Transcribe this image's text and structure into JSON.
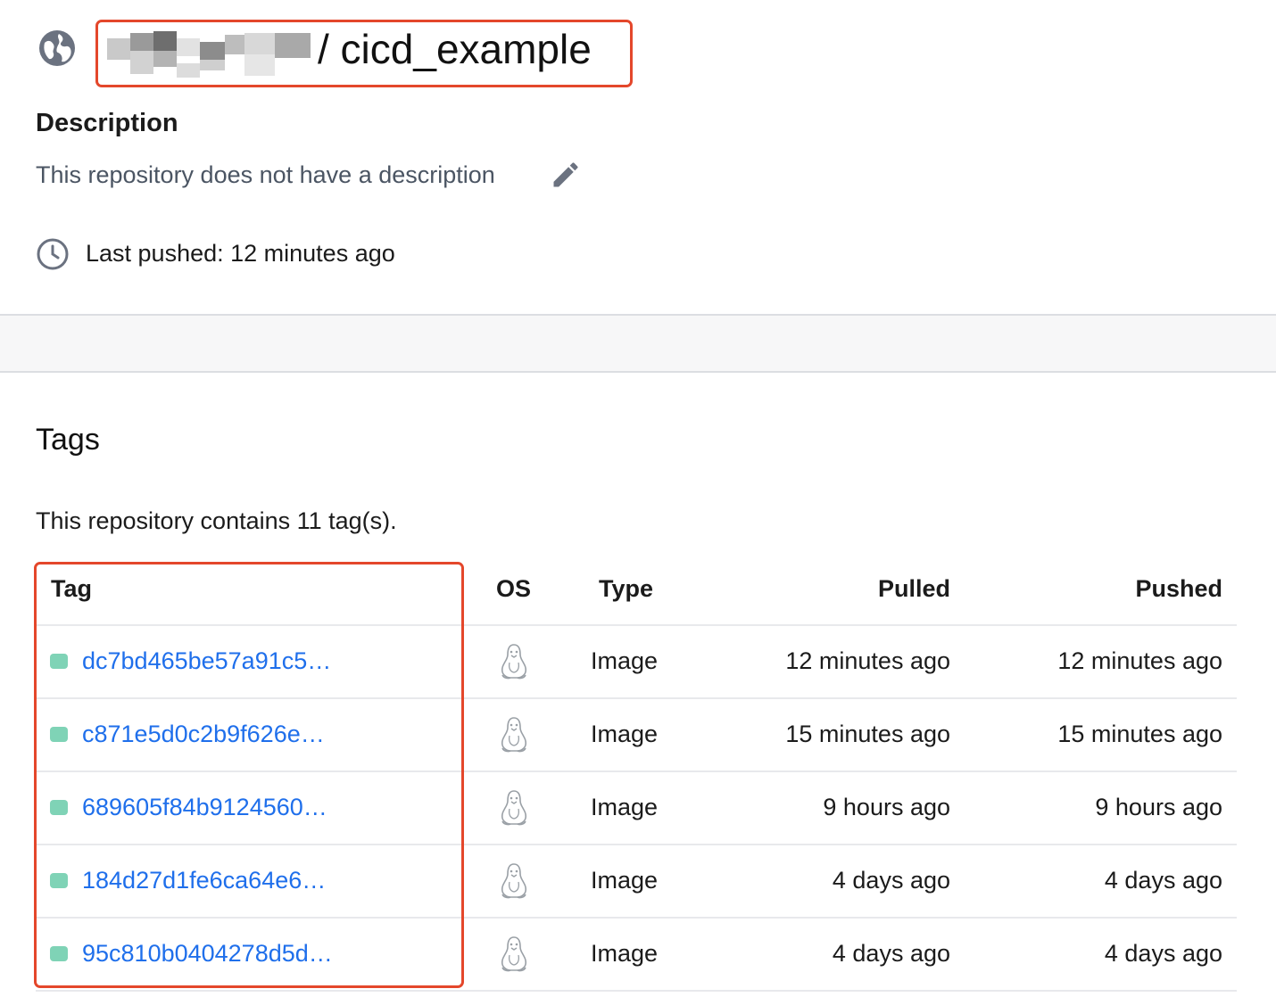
{
  "header": {
    "owner_hidden": "",
    "repo_title": "/ cicd_example",
    "globe_icon": "globe-icon"
  },
  "description": {
    "heading": "Description",
    "text": "This repository does not have a description",
    "edit_icon": "pencil-icon"
  },
  "last_pushed": {
    "text": "Last pushed: 12 minutes ago",
    "icon": "clock-icon"
  },
  "tags": {
    "heading": "Tags",
    "count_text": "This repository contains 11 tag(s).",
    "columns": {
      "tag": "Tag",
      "os": "OS",
      "type": "Type",
      "pulled": "Pulled",
      "pushed": "Pushed"
    },
    "rows": [
      {
        "tag": "dc7bd465be57a91c5…",
        "os_icon": "linux-tux-icon",
        "type": "Image",
        "pulled": "12 minutes ago",
        "pushed": "12 minutes ago"
      },
      {
        "tag": "c871e5d0c2b9f626e…",
        "os_icon": "linux-tux-icon",
        "type": "Image",
        "pulled": "15 minutes ago",
        "pushed": "15 minutes ago"
      },
      {
        "tag": "689605f84b9124560…",
        "os_icon": "linux-tux-icon",
        "type": "Image",
        "pulled": "9 hours ago",
        "pushed": "9 hours ago"
      },
      {
        "tag": "184d27d1fe6ca64e6…",
        "os_icon": "linux-tux-icon",
        "type": "Image",
        "pulled": "4 days ago",
        "pushed": "4 days ago"
      },
      {
        "tag": "95c810b0404278d5d…",
        "os_icon": "linux-tux-icon",
        "type": "Image",
        "pulled": "4 days ago",
        "pushed": "4 days ago"
      }
    ]
  },
  "colors": {
    "highlight": "#e4472b",
    "link": "#1f6feb",
    "status_dot": "#7fd3b6"
  }
}
